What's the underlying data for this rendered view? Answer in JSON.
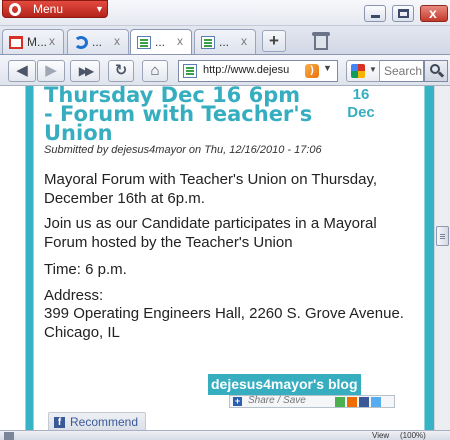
{
  "window": {
    "menu_label": "Menu"
  },
  "tabs": [
    {
      "title": "M...",
      "icon": "gmail-icon"
    },
    {
      "title": "...",
      "icon": "ie-icon"
    },
    {
      "title": "...",
      "icon": "page-icon"
    },
    {
      "title": "...",
      "icon": "page-icon"
    }
  ],
  "nav": {
    "url": "http://www.dejesu",
    "search_placeholder": "Search"
  },
  "post": {
    "title": "Thursday Dec 16 6pm - Forum with Teacher's Union",
    "date_day": "16",
    "date_month": "Dec",
    "submitted": "Submitted by dejesus4mayor on Thu, 12/16/2010 - 17:06",
    "para1": "Mayoral Forum with Teacher's Union on Thursday, December 16th at 6p.m.",
    "para2": "Join us as our Candidate participates in a Mayoral Forum hosted by the Teacher's Union",
    "para3": "Time: 6 p.m.",
    "para4": "Address:",
    "para5": "399 Operating Engineers Hall, 2260 S. Grove Avenue. Chicago, IL",
    "blog_link": "dejesus4mayor's blog",
    "share_label": "Share / Save",
    "recommend_label": "Recommend"
  },
  "status": {
    "view_label": "View",
    "zoom": "(100%)"
  },
  "colors": {
    "accent": "#36aec0",
    "menu_red": "#c9352b"
  }
}
